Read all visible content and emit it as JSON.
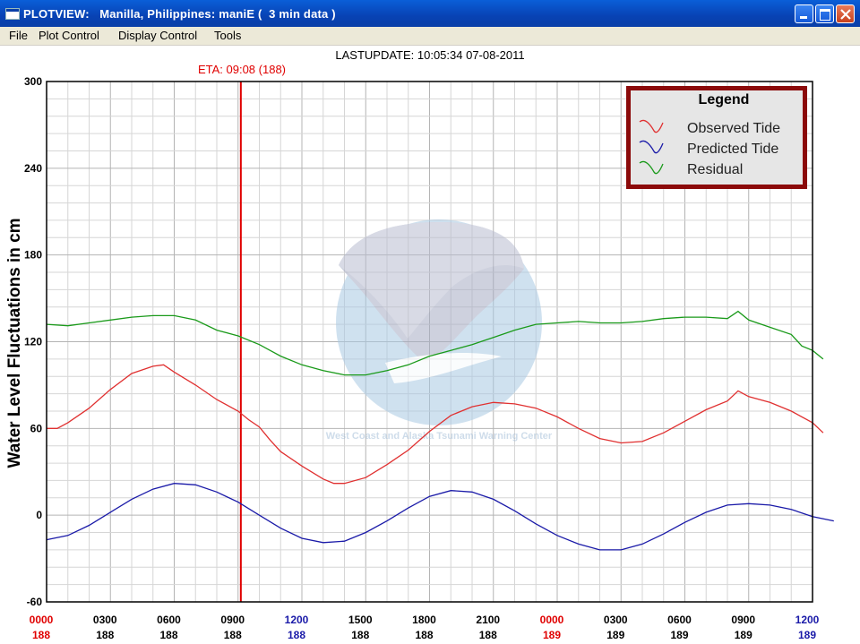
{
  "window": {
    "title": "PLOTVIEW:   Manilla, Philippines: maniE (  3 min data )"
  },
  "menu": [
    {
      "label": "File"
    },
    {
      "label": "Plot Control"
    },
    {
      "label": "Display Control"
    },
    {
      "label": "Tools"
    }
  ],
  "header": {
    "last_update": "LASTUPDATE: 10:05:34  07-08-2011",
    "eta": "ETA: 09:08 (188)"
  },
  "watermark": {
    "text": "West Coast and Alaska Tsunami Warning Center"
  },
  "legend": {
    "title": "Legend",
    "items": [
      {
        "label": "Observed Tide",
        "color": "#e03030"
      },
      {
        "label": "Predicted Tide",
        "color": "#1a1aa8"
      },
      {
        "label": "Residual",
        "color": "#1a9a1a"
      }
    ]
  },
  "colors": {
    "observed": "#e03030",
    "predicted": "#1a1aa8",
    "residual": "#1a9a1a",
    "eta_line": "#e00000",
    "legend_border": "#8b0a0a",
    "grid": "#b4b4b4"
  },
  "chart_data": {
    "type": "line",
    "ylabel": "Water Level Fluctuations in cm",
    "ylim": [
      -60,
      300
    ],
    "yticks": [
      "300",
      "240",
      "180",
      "120",
      "60",
      "0",
      "-60"
    ],
    "xlim_hours": [
      0,
      36
    ],
    "xticks": [
      {
        "time": "0000",
        "day": "188",
        "time_color": "#e00000",
        "day_color": "#e00000"
      },
      {
        "time": "0300",
        "day": "188",
        "time_color": "#000000",
        "day_color": "#000000"
      },
      {
        "time": "0600",
        "day": "188",
        "time_color": "#000000",
        "day_color": "#000000"
      },
      {
        "time": "0900",
        "day": "188",
        "time_color": "#000000",
        "day_color": "#000000"
      },
      {
        "time": "1200",
        "day": "188",
        "time_color": "#1a1aa8",
        "day_color": "#1a1aa8"
      },
      {
        "time": "1500",
        "day": "188",
        "time_color": "#000000",
        "day_color": "#000000"
      },
      {
        "time": "1800",
        "day": "188",
        "time_color": "#000000",
        "day_color": "#000000"
      },
      {
        "time": "2100",
        "day": "188",
        "time_color": "#000000",
        "day_color": "#000000"
      },
      {
        "time": "0000",
        "day": "189",
        "time_color": "#e00000",
        "day_color": "#e00000"
      },
      {
        "time": "0300",
        "day": "189",
        "time_color": "#000000",
        "day_color": "#000000"
      },
      {
        "time": "0600",
        "day": "189",
        "time_color": "#000000",
        "day_color": "#000000"
      },
      {
        "time": "0900",
        "day": "189",
        "time_color": "#000000",
        "day_color": "#000000"
      },
      {
        "time": "1200",
        "day": "189",
        "time_color": "#1a1aa8",
        "day_color": "#1a1aa8"
      }
    ],
    "eta_hour": 9.13,
    "grid": true,
    "legend_position": "top-right",
    "series": [
      {
        "name": "Observed Tide",
        "points": [
          [
            0,
            60
          ],
          [
            0.5,
            60
          ],
          [
            1,
            64
          ],
          [
            2,
            74
          ],
          [
            3,
            87
          ],
          [
            4,
            98
          ],
          [
            5,
            103
          ],
          [
            5.5,
            104
          ],
          [
            6,
            99
          ],
          [
            7,
            90
          ],
          [
            8,
            80
          ],
          [
            9,
            72
          ],
          [
            9.5,
            66
          ],
          [
            10,
            61
          ],
          [
            10.5,
            52
          ],
          [
            11,
            44
          ],
          [
            12,
            34
          ],
          [
            13,
            25
          ],
          [
            13.5,
            22
          ],
          [
            14,
            22
          ],
          [
            15,
            26
          ],
          [
            16,
            35
          ],
          [
            17,
            45
          ],
          [
            18,
            58
          ],
          [
            19,
            69
          ],
          [
            20,
            75
          ],
          [
            21,
            78
          ],
          [
            22,
            77
          ],
          [
            23,
            74
          ],
          [
            24,
            68
          ],
          [
            25,
            60
          ],
          [
            26,
            53
          ],
          [
            27,
            50
          ],
          [
            28,
            51
          ],
          [
            29,
            57
          ],
          [
            30,
            65
          ],
          [
            31,
            73
          ],
          [
            32,
            79
          ],
          [
            32.5,
            86
          ],
          [
            33,
            82
          ],
          [
            34,
            78
          ],
          [
            35,
            72
          ],
          [
            36,
            64
          ],
          [
            36.5,
            57
          ]
        ]
      },
      {
        "name": "Predicted Tide",
        "points": [
          [
            0,
            -17
          ],
          [
            1,
            -14
          ],
          [
            2,
            -7
          ],
          [
            3,
            2
          ],
          [
            4,
            11
          ],
          [
            5,
            18
          ],
          [
            6,
            22
          ],
          [
            7,
            21
          ],
          [
            8,
            16
          ],
          [
            9,
            9
          ],
          [
            10,
            0
          ],
          [
            11,
            -9
          ],
          [
            12,
            -16
          ],
          [
            13,
            -19
          ],
          [
            14,
            -18
          ],
          [
            15,
            -12
          ],
          [
            16,
            -4
          ],
          [
            17,
            5
          ],
          [
            18,
            13
          ],
          [
            19,
            17
          ],
          [
            20,
            16
          ],
          [
            21,
            11
          ],
          [
            22,
            3
          ],
          [
            23,
            -6
          ],
          [
            24,
            -14
          ],
          [
            25,
            -20
          ],
          [
            26,
            -24
          ],
          [
            27,
            -24
          ],
          [
            28,
            -20
          ],
          [
            29,
            -13
          ],
          [
            30,
            -5
          ],
          [
            31,
            2
          ],
          [
            32,
            7
          ],
          [
            33,
            8
          ],
          [
            34,
            7
          ],
          [
            35,
            4
          ],
          [
            36,
            -1
          ],
          [
            37,
            -4
          ]
        ]
      },
      {
        "name": "Residual",
        "points": [
          [
            0,
            132
          ],
          [
            1,
            131
          ],
          [
            2,
            133
          ],
          [
            3,
            135
          ],
          [
            4,
            137
          ],
          [
            5,
            138
          ],
          [
            6,
            138
          ],
          [
            7,
            135
          ],
          [
            8,
            128
          ],
          [
            9,
            124
          ],
          [
            10,
            118
          ],
          [
            10.5,
            114
          ],
          [
            11,
            110
          ],
          [
            12,
            104
          ],
          [
            13,
            100
          ],
          [
            14,
            97
          ],
          [
            15,
            97
          ],
          [
            16,
            100
          ],
          [
            17,
            104
          ],
          [
            18,
            110
          ],
          [
            19,
            114
          ],
          [
            20,
            118
          ],
          [
            21,
            123
          ],
          [
            22,
            128
          ],
          [
            23,
            132
          ],
          [
            24,
            133
          ],
          [
            25,
            134
          ],
          [
            26,
            133
          ],
          [
            27,
            133
          ],
          [
            28,
            134
          ],
          [
            29,
            136
          ],
          [
            30,
            137
          ],
          [
            31,
            137
          ],
          [
            32,
            136
          ],
          [
            32.5,
            141
          ],
          [
            33,
            135
          ],
          [
            34,
            130
          ],
          [
            35,
            125
          ],
          [
            35.5,
            117
          ],
          [
            36,
            114
          ],
          [
            36.5,
            108
          ]
        ]
      }
    ]
  }
}
